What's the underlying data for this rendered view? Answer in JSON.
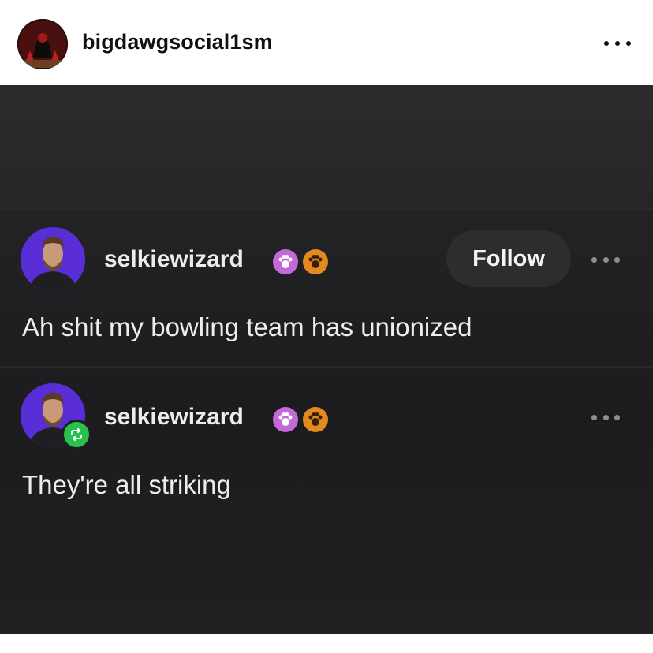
{
  "instagram": {
    "username": "bigdawgsocial1sm"
  },
  "posts": [
    {
      "username": "selkiewizard",
      "follow_label": "Follow",
      "text": "Ah shit my bowling team has unionized"
    },
    {
      "username": "selkiewizard",
      "text": "They're all striking"
    }
  ],
  "colors": {
    "accent_purple": "#5b2fd0",
    "reblog_green": "#27c24c",
    "badge_pink": "#c46ad8",
    "badge_orange": "#e38a1e"
  }
}
